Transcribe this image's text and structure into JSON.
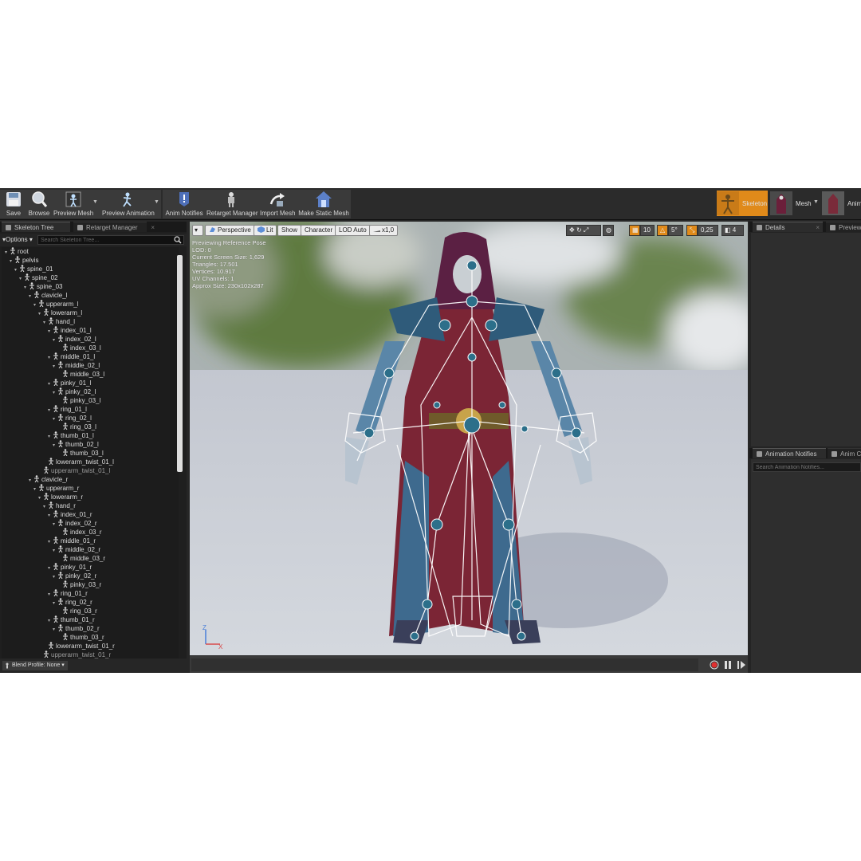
{
  "toolbar": {
    "buttons": [
      {
        "label": "Save",
        "icon": "save-icon"
      },
      {
        "label": "Browse",
        "icon": "browse-icon"
      },
      {
        "label": "Preview Mesh",
        "icon": "preview-mesh-icon"
      },
      {
        "label": "Preview Animation",
        "icon": "preview-animation-icon"
      },
      {
        "label": "Anim Notifies",
        "icon": "anim-notifies-icon"
      },
      {
        "label": "Retarget Manager",
        "icon": "retarget-manager-icon"
      },
      {
        "label": "Import Mesh",
        "icon": "import-mesh-icon"
      },
      {
        "label": "Make Static Mesh",
        "icon": "make-static-mesh-icon"
      }
    ],
    "modes": [
      {
        "label": "Skeleton",
        "active": true
      },
      {
        "label": "Mesh",
        "active": false
      },
      {
        "label": "Animation",
        "active": false
      }
    ]
  },
  "left_panel": {
    "tabs": [
      "Skeleton Tree",
      "Retarget Manager"
    ],
    "options_label": "Options",
    "search_placeholder": "Search Skeleton Tree...",
    "blend_profile_label": "Blend Profile: None",
    "bones": [
      {
        "name": "root",
        "depth": 0,
        "virtual": false
      },
      {
        "name": "pelvis",
        "depth": 1,
        "virtual": false
      },
      {
        "name": "spine_01",
        "depth": 2,
        "virtual": false
      },
      {
        "name": "spine_02",
        "depth": 3,
        "virtual": false
      },
      {
        "name": "spine_03",
        "depth": 4,
        "virtual": false
      },
      {
        "name": "clavicle_l",
        "depth": 5,
        "virtual": false
      },
      {
        "name": "upperarm_l",
        "depth": 6,
        "virtual": false
      },
      {
        "name": "lowerarm_l",
        "depth": 7,
        "virtual": false
      },
      {
        "name": "hand_l",
        "depth": 8,
        "virtual": false
      },
      {
        "name": "index_01_l",
        "depth": 9,
        "virtual": false
      },
      {
        "name": "index_02_l",
        "depth": 10,
        "virtual": false
      },
      {
        "name": "index_03_l",
        "depth": 11,
        "virtual": false
      },
      {
        "name": "middle_01_l",
        "depth": 9,
        "virtual": false
      },
      {
        "name": "middle_02_l",
        "depth": 10,
        "virtual": false
      },
      {
        "name": "middle_03_l",
        "depth": 11,
        "virtual": false
      },
      {
        "name": "pinky_01_l",
        "depth": 9,
        "virtual": false
      },
      {
        "name": "pinky_02_l",
        "depth": 10,
        "virtual": false
      },
      {
        "name": "pinky_03_l",
        "depth": 11,
        "virtual": false
      },
      {
        "name": "ring_01_l",
        "depth": 9,
        "virtual": false
      },
      {
        "name": "ring_02_l",
        "depth": 10,
        "virtual": false
      },
      {
        "name": "ring_03_l",
        "depth": 11,
        "virtual": false
      },
      {
        "name": "thumb_01_l",
        "depth": 9,
        "virtual": false
      },
      {
        "name": "thumb_02_l",
        "depth": 10,
        "virtual": false
      },
      {
        "name": "thumb_03_l",
        "depth": 11,
        "virtual": false
      },
      {
        "name": "lowerarm_twist_01_l",
        "depth": 8,
        "virtual": false
      },
      {
        "name": "upperarm_twist_01_l",
        "depth": 7,
        "virtual": true
      },
      {
        "name": "clavicle_r",
        "depth": 5,
        "virtual": false
      },
      {
        "name": "upperarm_r",
        "depth": 6,
        "virtual": false
      },
      {
        "name": "lowerarm_r",
        "depth": 7,
        "virtual": false
      },
      {
        "name": "hand_r",
        "depth": 8,
        "virtual": false
      },
      {
        "name": "index_01_r",
        "depth": 9,
        "virtual": false
      },
      {
        "name": "index_02_r",
        "depth": 10,
        "virtual": false
      },
      {
        "name": "index_03_r",
        "depth": 11,
        "virtual": false
      },
      {
        "name": "middle_01_r",
        "depth": 9,
        "virtual": false
      },
      {
        "name": "middle_02_r",
        "depth": 10,
        "virtual": false
      },
      {
        "name": "middle_03_r",
        "depth": 11,
        "virtual": false
      },
      {
        "name": "pinky_01_r",
        "depth": 9,
        "virtual": false
      },
      {
        "name": "pinky_02_r",
        "depth": 10,
        "virtual": false
      },
      {
        "name": "pinky_03_r",
        "depth": 11,
        "virtual": false
      },
      {
        "name": "ring_01_r",
        "depth": 9,
        "virtual": false
      },
      {
        "name": "ring_02_r",
        "depth": 10,
        "virtual": false
      },
      {
        "name": "ring_03_r",
        "depth": 11,
        "virtual": false
      },
      {
        "name": "thumb_01_r",
        "depth": 9,
        "virtual": false
      },
      {
        "name": "thumb_02_r",
        "depth": 10,
        "virtual": false
      },
      {
        "name": "thumb_03_r",
        "depth": 11,
        "virtual": false
      },
      {
        "name": "lowerarm_twist_01_r",
        "depth": 8,
        "virtual": false
      },
      {
        "name": "upperarm_twist_01_r",
        "depth": 7,
        "virtual": true
      }
    ]
  },
  "viewport": {
    "perspective_label": "Perspective",
    "lit_label": "Lit",
    "show_label": "Show",
    "character_label": "Character",
    "lod_label": "LOD Auto",
    "speed_label": "x1,0",
    "grid_value": "10",
    "angle_value": "5°",
    "scale_value": "0,25",
    "camera_speed": "4",
    "stats": [
      "Previewing Reference Pose",
      "LOD: 0",
      "Current Screen Size: 1,629",
      "Triangles: 17.501",
      "Vertices: 10.917",
      "UV Channels: 1",
      "Approx Size: 230x102x287"
    ],
    "axis_x": "X",
    "axis_z": "Z"
  },
  "right_panel": {
    "top_tabs": [
      "Details",
      "Preview"
    ],
    "bottom_tabs": [
      "Animation Notifies",
      "Anim Cu"
    ],
    "anim_search_placeholder": "Search Animation Notifies..."
  },
  "colors": {
    "accent_orange": "#e08a1a",
    "panel_dark": "#1f1f1f",
    "bone_white": "#ffffff"
  }
}
